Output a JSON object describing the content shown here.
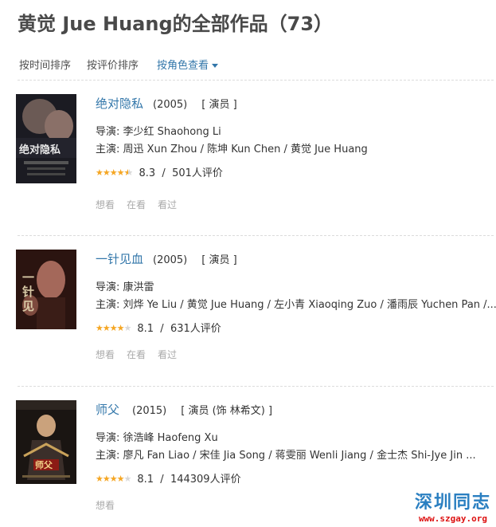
{
  "page": {
    "title": "黄觉 Jue Huang的全部作品（73）"
  },
  "sort": {
    "by_time": "按时间排序",
    "by_rating": "按评价排序",
    "by_role": "按角色查看"
  },
  "movies": [
    {
      "title": "绝对隐私",
      "year": "(2005)",
      "role": "[ 演员 ]",
      "director": "导演: 李少红 Shaohong Li",
      "cast": "主演: 周迅 Xun Zhou / 陈坤 Kun Chen / 黄觉 Jue Huang",
      "stars": 4.5,
      "score": "8.3",
      "sep": "/",
      "count": "501人评价",
      "actions": [
        "想看",
        "在看",
        "看过"
      ]
    },
    {
      "title": "一针见血",
      "year": "(2005)",
      "role": "[ 演员 ]",
      "director": "导演: 康洪雷",
      "cast": "主演: 刘烨 Ye Liu / 黄觉 Jue Huang / 左小青 Xiaoqing Zuo / 潘雨辰 Yuchen Pan /...",
      "stars": 4,
      "score": "8.1",
      "sep": "/",
      "count": "631人评价",
      "actions": [
        "想看",
        "在看",
        "看过"
      ]
    },
    {
      "title": "师父",
      "year": "(2015)",
      "role": "[ 演员 (饰 林希文) ]",
      "director": "导演: 徐浩峰 Haofeng Xu",
      "cast": "主演: 廖凡 Fan Liao / 宋佳 Jia Song / 蒋雯丽 Wenli Jiang / 金士杰 Shi-Jye Jin ...",
      "stars": 4,
      "score": "8.1",
      "sep": "/",
      "count": "144309人评价",
      "actions": [
        "想看"
      ]
    }
  ],
  "watermark": {
    "big": "深圳同志",
    "small": "www.szgay.org"
  },
  "colors": {
    "link": "#3377aa",
    "star": "#f5a623",
    "muted": "#aaaaaa"
  }
}
